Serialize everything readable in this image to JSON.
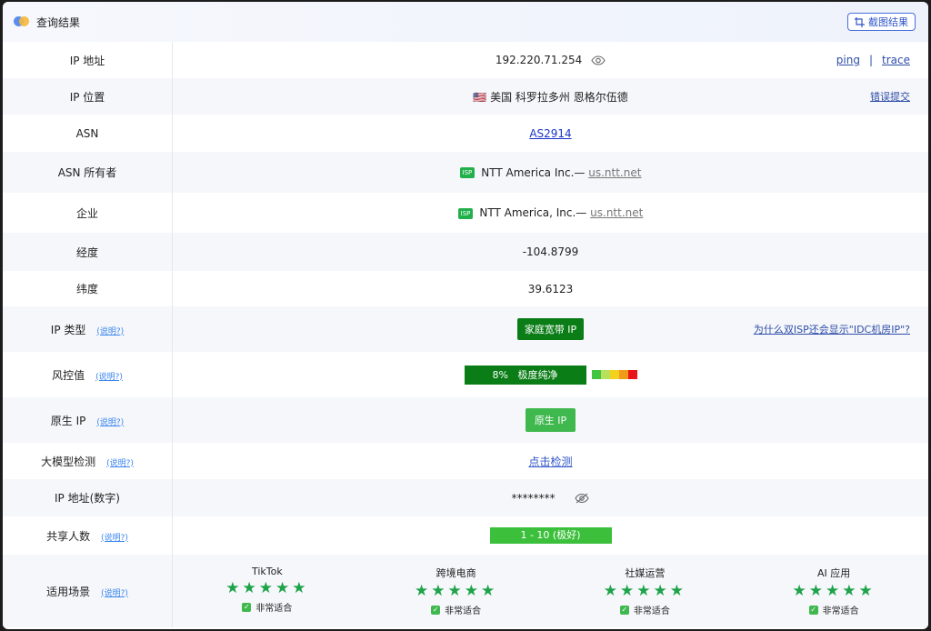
{
  "header": {
    "title": "查询结果",
    "screenshot_label": "截图结果"
  },
  "help_label": "(说明?)",
  "rows": {
    "ip": {
      "label": "IP 地址",
      "value": "192.220.71.254",
      "ping": "ping",
      "sep": "|",
      "trace": "trace"
    },
    "location": {
      "label": "IP 位置",
      "flag": "🇺🇸",
      "value": "美国 科罗拉多州 恩格尔伍德",
      "link": "错误提交"
    },
    "asn": {
      "label": "ASN",
      "value": "AS2914"
    },
    "asn_owner": {
      "label": "ASN 所有者",
      "badge": "ISP",
      "name": "NTT America Inc.—",
      "domain": "us.ntt.net"
    },
    "company": {
      "label": "企业",
      "badge": "ISP",
      "name": "NTT America, Inc.—",
      "domain": "us.ntt.net"
    },
    "longitude": {
      "label": "经度",
      "value": "-104.8799"
    },
    "latitude": {
      "label": "纬度",
      "value": "39.6123"
    },
    "ip_type": {
      "label": "IP 类型",
      "value": "家庭宽带 IP",
      "link": "为什么双ISP还会显示\"IDC机房IP\"?"
    },
    "risk": {
      "label": "风控值",
      "percent": "8%",
      "text": "极度纯净",
      "score": 0.08,
      "scale_colors": [
        "#41c43f",
        "#b8e05a",
        "#f2d21f",
        "#f29a1a",
        "#e9151a"
      ]
    },
    "native": {
      "label": "原生 IP",
      "value": "原生 IP"
    },
    "llm": {
      "label": "大模型检测",
      "value": "点击检测"
    },
    "ip_numeric": {
      "label": "IP 地址(数字)",
      "value": "********"
    },
    "shared": {
      "label": "共享人数",
      "value": "1 - 10 (极好)"
    },
    "scenarios": {
      "label": "适用场景",
      "items": [
        {
          "name": "TikTok",
          "stars": 5,
          "verdict": "非常适合"
        },
        {
          "name": "跨境电商",
          "stars": 5,
          "verdict": "非常适合"
        },
        {
          "name": "社媒运营",
          "stars": 5,
          "verdict": "非常适合"
        },
        {
          "name": "AI 应用",
          "stars": 5,
          "verdict": "非常适合"
        }
      ]
    }
  }
}
